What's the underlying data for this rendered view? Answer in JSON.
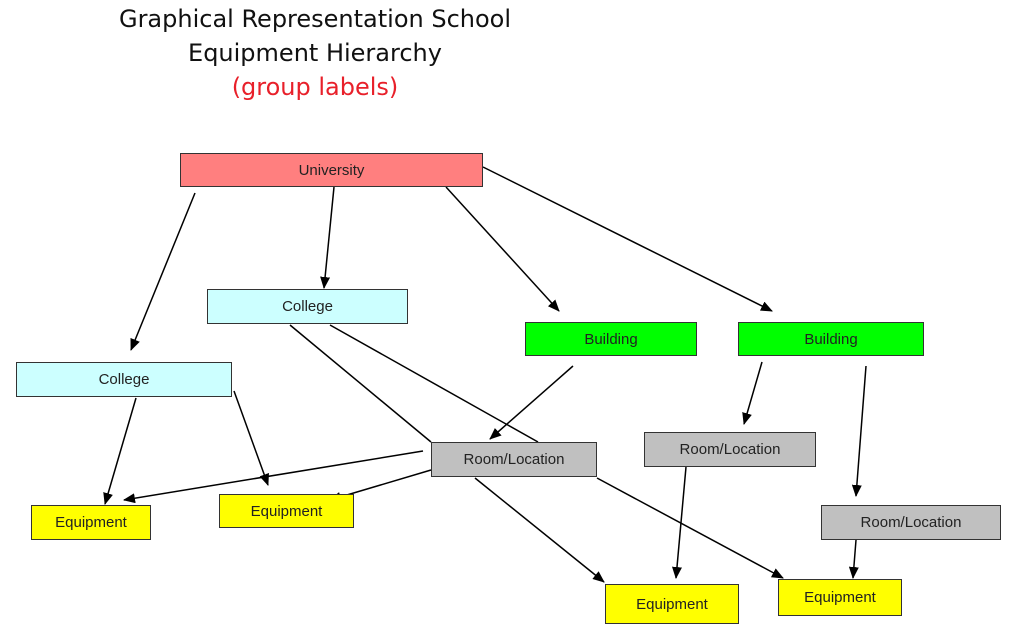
{
  "title": {
    "line1": "Graphical Representation School",
    "line2": "Equipment Hierarchy",
    "line3": "(group labels)"
  },
  "colors": {
    "university": "#ff7f7f",
    "college": "#ccffff",
    "building": "#00ff00",
    "room": "#c0c0c0",
    "equipment": "#ffff00",
    "subtitle": "#e8202a"
  },
  "nodes": [
    {
      "id": "university",
      "label": "University",
      "type": "university"
    },
    {
      "id": "college-1",
      "label": "College",
      "type": "college"
    },
    {
      "id": "college-2",
      "label": "College",
      "type": "college"
    },
    {
      "id": "building-1",
      "label": "Building",
      "type": "building"
    },
    {
      "id": "building-2",
      "label": "Building",
      "type": "building"
    },
    {
      "id": "room-1",
      "label": "Room/Location",
      "type": "room"
    },
    {
      "id": "room-2",
      "label": "Room/Location",
      "type": "room"
    },
    {
      "id": "room-3",
      "label": "Room/Location",
      "type": "room"
    },
    {
      "id": "equipment-1",
      "label": "Equipment",
      "type": "equipment"
    },
    {
      "id": "equipment-2",
      "label": "Equipment",
      "type": "equipment"
    },
    {
      "id": "equipment-3",
      "label": "Equipment",
      "type": "equipment"
    },
    {
      "id": "equipment-4",
      "label": "Equipment",
      "type": "equipment"
    }
  ],
  "edges": [
    {
      "from": "university",
      "to": "college-2",
      "arrow": true
    },
    {
      "from": "university",
      "to": "college-1",
      "arrow": true
    },
    {
      "from": "university",
      "to": "building-1",
      "arrow": true
    },
    {
      "from": "university",
      "to": "building-2",
      "arrow": true
    },
    {
      "from": "college-2",
      "to": "equipment-1",
      "arrow": true
    },
    {
      "from": "college-2",
      "to": "equipment-2",
      "arrow": true
    },
    {
      "from": "college-1",
      "to": "room-1",
      "arrow": false
    },
    {
      "from": "college-1",
      "to": "room-1",
      "arrow": false
    },
    {
      "from": "building-1",
      "to": "room-1",
      "arrow": true
    },
    {
      "from": "building-2",
      "to": "room-2",
      "arrow": true
    },
    {
      "from": "building-2",
      "to": "room-3",
      "arrow": true
    },
    {
      "from": "room-1",
      "to": "equipment-1",
      "arrow": true
    },
    {
      "from": "room-1",
      "to": "equipment-2",
      "arrow": true
    },
    {
      "from": "room-1",
      "to": "equipment-3",
      "arrow": true
    },
    {
      "from": "room-1",
      "to": "equipment-4",
      "arrow": true
    },
    {
      "from": "room-2",
      "to": "equipment-3",
      "arrow": true
    },
    {
      "from": "room-3",
      "to": "equipment-4",
      "arrow": true
    }
  ]
}
